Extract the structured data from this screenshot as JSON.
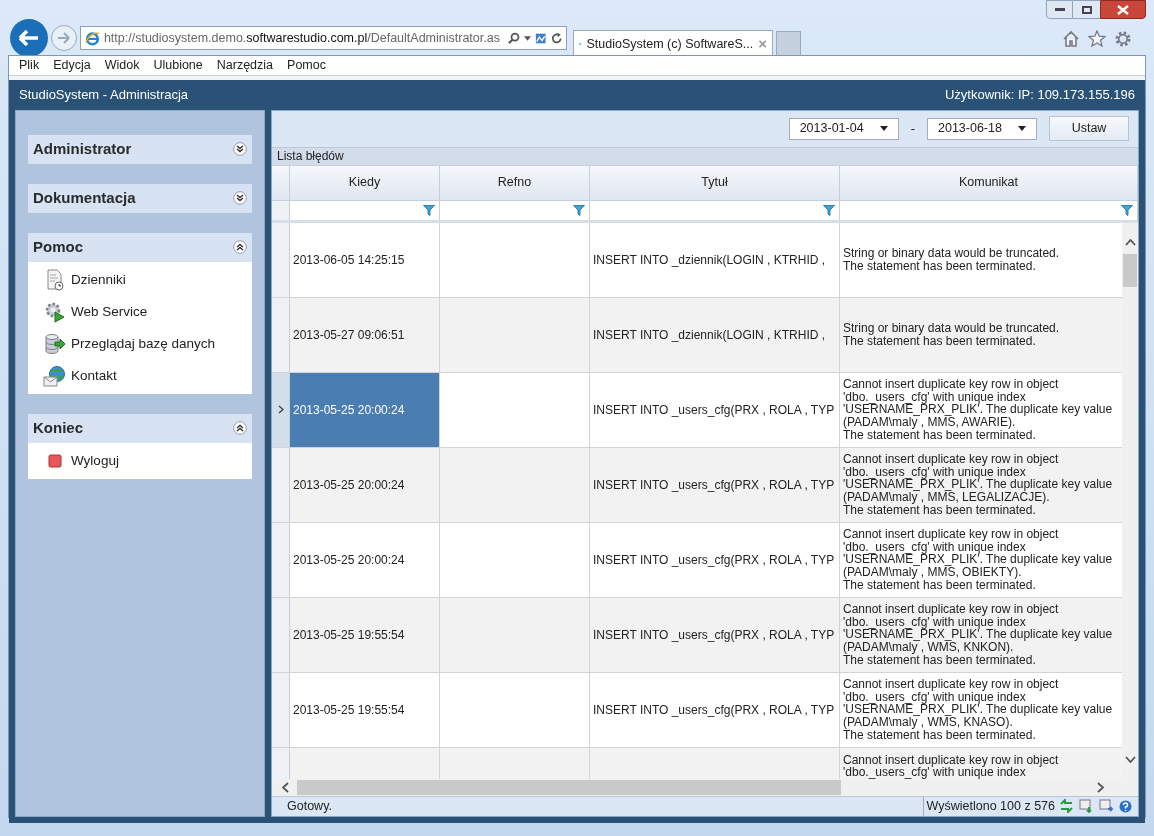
{
  "browser": {
    "address": "http://studiosystem.demo.**softwarestudio.com.pl**/DefaultAdministrator.as",
    "tabs": [
      {
        "title": "StudioSystem (c) SoftwareS...",
        "selected": true
      }
    ],
    "close_glyph": "×",
    "menu": [
      "Plik",
      "Edycja",
      "Widok",
      "Ulubione",
      "Narzędzia",
      "Pomoc"
    ]
  },
  "app": {
    "title": "StudioSystem - Administracja",
    "user": "Użytkownik: IP: 109.173.155.196"
  },
  "sidebar": {
    "sections": [
      {
        "title": "Administrator",
        "expanded": false
      },
      {
        "title": "Dokumentacja",
        "expanded": false
      },
      {
        "title": "Pomoc",
        "expanded": true,
        "items": [
          {
            "label": "Dzienniki",
            "kind": "log"
          },
          {
            "label": "Web Service",
            "kind": "service"
          },
          {
            "label": "Przeglądaj bazę danych",
            "kind": "database"
          },
          {
            "label": "Kontakt",
            "kind": "contact"
          }
        ]
      },
      {
        "title": "Koniec",
        "expanded": true,
        "items": [
          {
            "label": "Wyloguj",
            "kind": "logout"
          }
        ]
      }
    ]
  },
  "toolbar": {
    "date_from": "2013-01-04",
    "separator": "-",
    "date_to": "2013-06-18",
    "button": "Ustaw"
  },
  "grid": {
    "caption": "Lista błędów",
    "columns": [
      "Kiedy",
      "Refno",
      "Tytuł",
      "Komunikat"
    ],
    "rows": [
      {
        "kiedy": "2013-06-05 14:25:15",
        "tytul": "INSERT INTO _dziennik(LOGIN , KTRHID ,",
        "komunikat": [
          "String or binary data would be truncated.",
          "The statement has been terminated."
        ],
        "selected": false
      },
      {
        "kiedy": "2013-05-27 09:06:51",
        "tytul": "INSERT INTO _dziennik(LOGIN , KTRHID ,",
        "komunikat": [
          "String or binary data would be truncated.",
          "The statement has been terminated."
        ],
        "selected": false
      },
      {
        "kiedy": "2013-05-25 20:00:24",
        "tytul": "INSERT INTO _users_cfg(PRX , ROLA , TYP",
        "komunikat": [
          "Cannot insert duplicate key row in object",
          "'dbo._users_cfg' with unique index",
          "'USERNAME_PRX_PLIK'. The duplicate key value",
          "(PADAM\\maly , MMS, AWARIE).",
          "The statement has been terminated."
        ],
        "selected": true
      },
      {
        "kiedy": "2013-05-25 20:00:24",
        "tytul": "INSERT INTO _users_cfg(PRX , ROLA , TYP",
        "komunikat": [
          "Cannot insert duplicate key row in object",
          "'dbo._users_cfg' with unique index",
          "'USERNAME_PRX_PLIK'. The duplicate key value",
          "(PADAM\\maly , MMS, LEGALIZACJE).",
          "The statement has been terminated."
        ],
        "selected": false
      },
      {
        "kiedy": "2013-05-25 20:00:24",
        "tytul": "INSERT INTO _users_cfg(PRX , ROLA , TYP",
        "komunikat": [
          "Cannot insert duplicate key row in object",
          "'dbo._users_cfg' with unique index",
          "'USERNAME_PRX_PLIK'. The duplicate key value",
          "(PADAM\\maly , MMS, OBIEKTY).",
          "The statement has been terminated."
        ],
        "selected": false
      },
      {
        "kiedy": "2013-05-25 19:55:54",
        "tytul": "INSERT INTO _users_cfg(PRX , ROLA , TYP",
        "komunikat": [
          "Cannot insert duplicate key row in object",
          "'dbo._users_cfg' with unique index",
          "'USERNAME_PRX_PLIK'. The duplicate key value",
          "(PADAM\\maly , WMS, KNKON).",
          "The statement has been terminated."
        ],
        "selected": false
      },
      {
        "kiedy": "2013-05-25 19:55:54",
        "tytul": "INSERT INTO _users_cfg(PRX , ROLA , TYP",
        "komunikat": [
          "Cannot insert duplicate key row in object",
          "'dbo._users_cfg' with unique index",
          "'USERNAME_PRX_PLIK'. The duplicate key value",
          "(PADAM\\maly , WMS, KNASO).",
          "The statement has been terminated."
        ],
        "selected": false
      },
      {
        "komunikat": [
          "Cannot insert duplicate key row in object",
          "'dbo._users_cfg' with unique index"
        ],
        "selected": false
      }
    ]
  },
  "status_bar": {
    "status": "Gotowy.",
    "count": "Wyświetlono 100 z 576"
  }
}
